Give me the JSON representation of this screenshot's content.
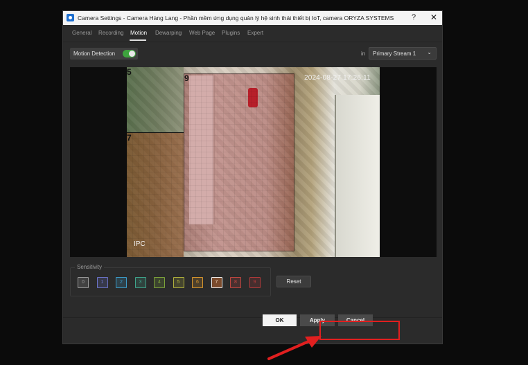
{
  "window": {
    "title": "Camera Settings - Camera Hàng Lang - Phần mềm ứng dụng quản lý hệ sinh thái thiết bị IoT, camera ORYZA SYSTEMS",
    "help": "?",
    "close": "✕"
  },
  "tabs": [
    {
      "label": "General"
    },
    {
      "label": "Recording"
    },
    {
      "label": "Motion"
    },
    {
      "label": "Dewarping"
    },
    {
      "label": "Web Page"
    },
    {
      "label": "Plugins"
    },
    {
      "label": "Expert"
    }
  ],
  "active_tab": "Motion",
  "motion": {
    "label": "Motion Detection",
    "enabled": true,
    "in_label": "in",
    "stream": "Primary Stream 1",
    "chevron": "⌄"
  },
  "video": {
    "timestamp": "2024-08-27 17:26:11",
    "osd": "IPC",
    "zone_labels": [
      "5",
      "9",
      "7"
    ]
  },
  "sensitivity": {
    "label": "Sensitivity",
    "levels": [
      "0",
      "1",
      "2",
      "3",
      "4",
      "5",
      "6",
      "7",
      "8",
      "9"
    ],
    "selected": "7",
    "colors": [
      "#9a9a9a",
      "#6b73c8",
      "#3c9bc8",
      "#3fa58c",
      "#7da33a",
      "#b1b13c",
      "#d8962d",
      "#e7b08a",
      "#c04640",
      "#b23a3a"
    ],
    "reset": "Reset"
  },
  "buttons": {
    "ok": "OK",
    "apply": "Apply",
    "cancel": "Cancel"
  },
  "annotation": {
    "highlight_color": "#e11f1f"
  }
}
